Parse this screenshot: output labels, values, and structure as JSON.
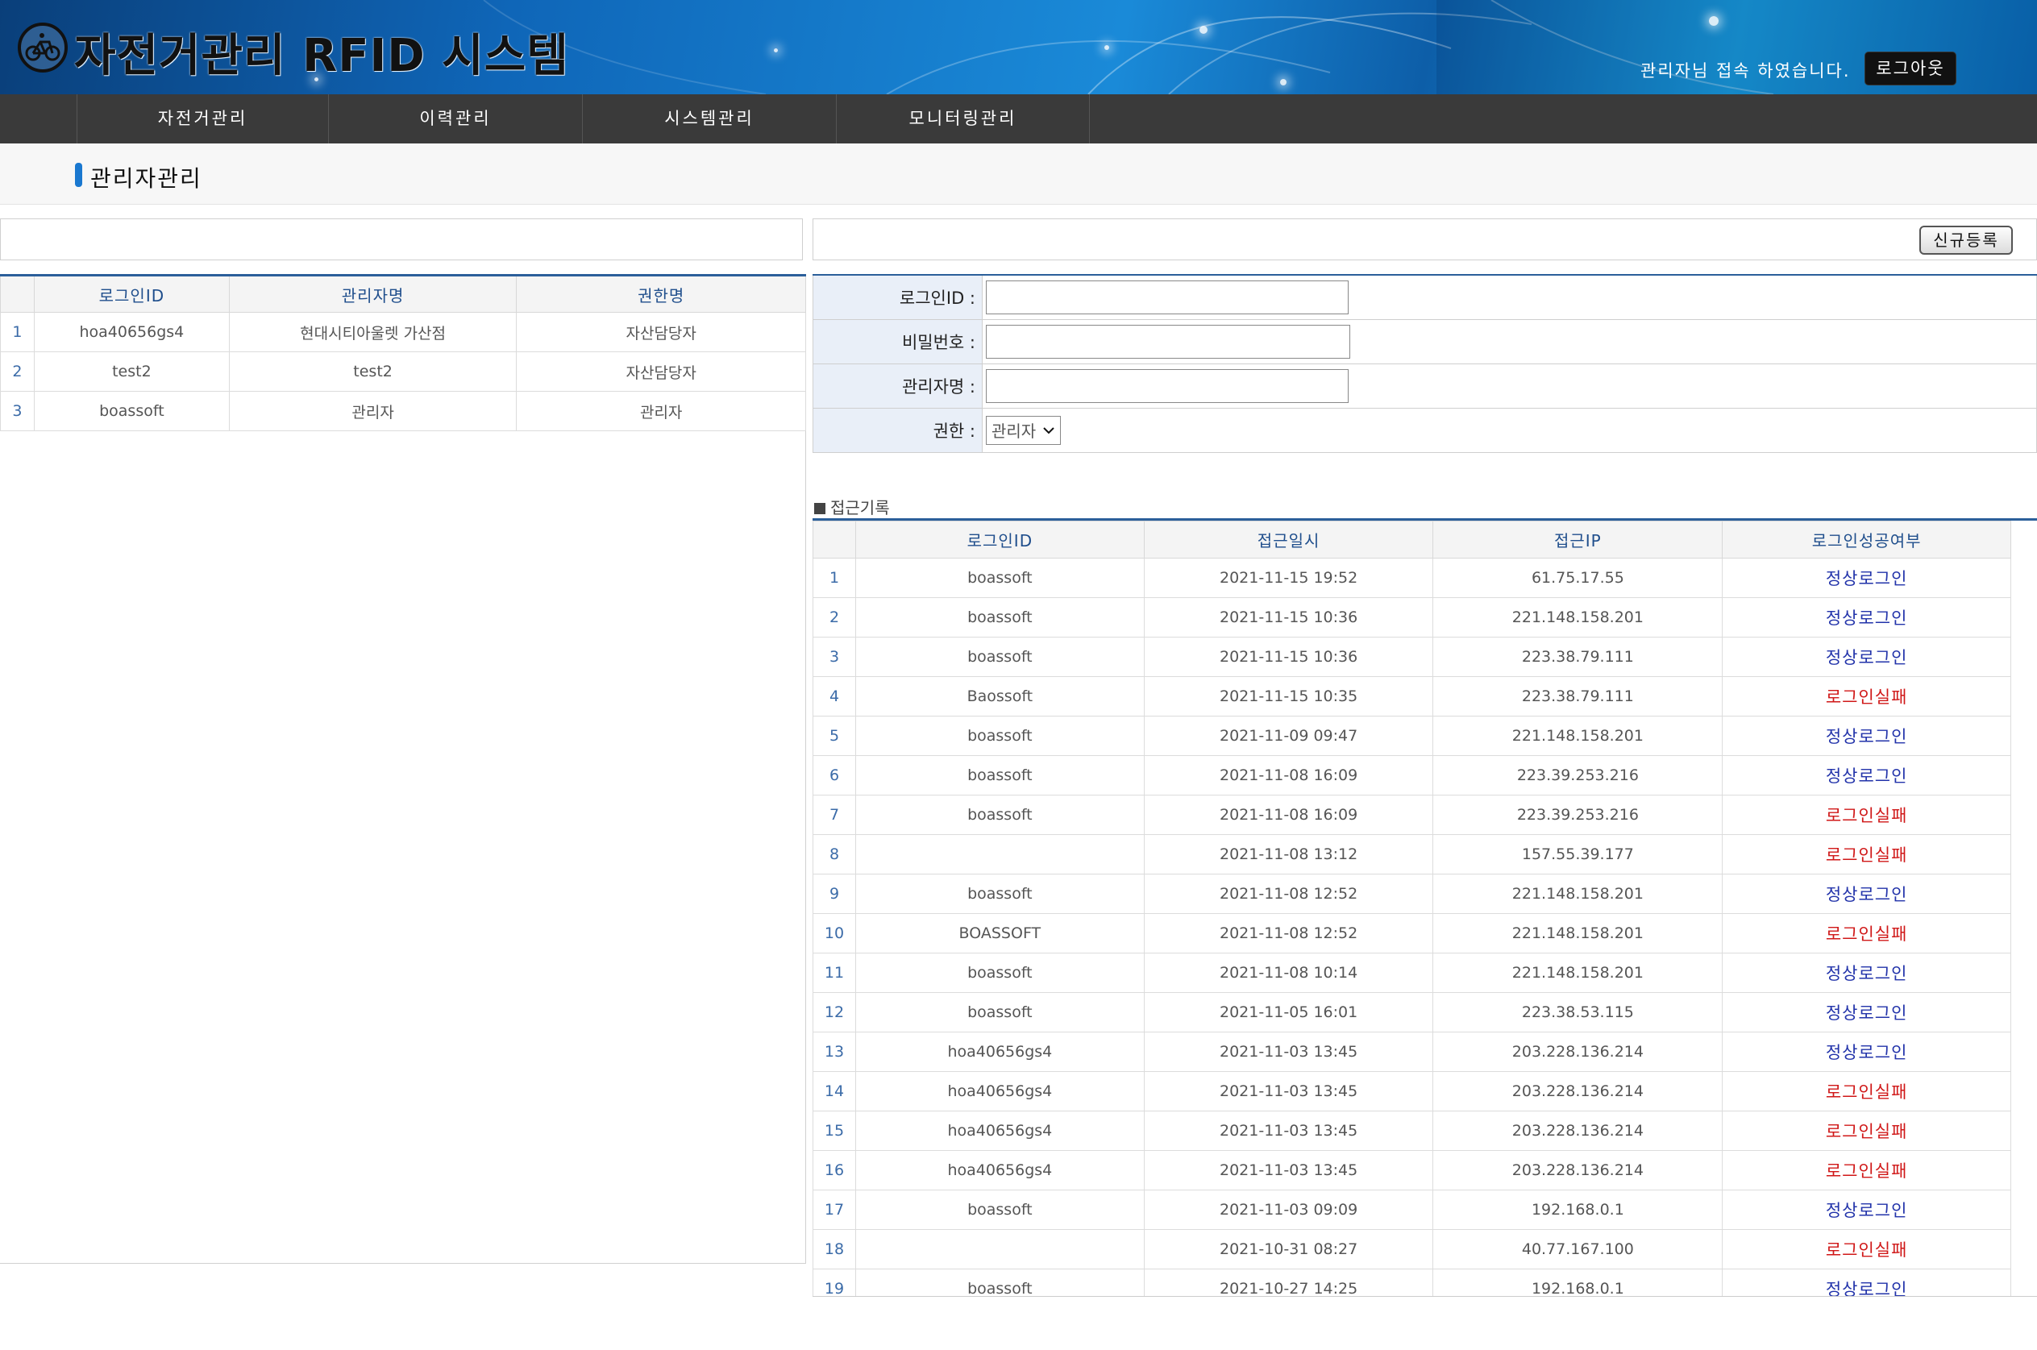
{
  "header": {
    "title": "자전거관리 RFID 시스템",
    "welcome": "관리자님 접속 하였습니다.",
    "logout_label": "로그아웃"
  },
  "nav": {
    "items": [
      {
        "label": "자전거관리"
      },
      {
        "label": "이력관리"
      },
      {
        "label": "시스템관리"
      },
      {
        "label": "모니터링관리"
      }
    ]
  },
  "page": {
    "title": "관리자관리",
    "new_button": "신규등록"
  },
  "admin_table": {
    "headers": [
      "로그인ID",
      "관리자명",
      "권한명"
    ],
    "rows": [
      {
        "no": "1",
        "id": "hoa40656gs4",
        "name": "현대시티아울렛 가산점",
        "role": "자산담당자"
      },
      {
        "no": "2",
        "id": "test2",
        "name": "test2",
        "role": "자산담당자"
      },
      {
        "no": "3",
        "id": "boassoft",
        "name": "관리자",
        "role": "관리자"
      }
    ]
  },
  "form": {
    "login_id_label": "로그인ID :",
    "password_label": "비밀번호 :",
    "manager_name_label": "관리자명 :",
    "role_label": "권한 :",
    "role_value": "관리자",
    "login_id_value": "",
    "password_value": "",
    "manager_name_value": ""
  },
  "access_log": {
    "label": "접근기록",
    "headers": [
      "로그인ID",
      "접근일시",
      "접근IP",
      "로그인성공여부"
    ],
    "rows": [
      {
        "no": "1",
        "id": "boassoft",
        "time": "2021-11-15 19:52",
        "ip": "61.75.17.55",
        "result": "정상로그인",
        "status": "ok"
      },
      {
        "no": "2",
        "id": "boassoft",
        "time": "2021-11-15 10:36",
        "ip": "221.148.158.201",
        "result": "정상로그인",
        "status": "ok"
      },
      {
        "no": "3",
        "id": "boassoft",
        "time": "2021-11-15 10:36",
        "ip": "223.38.79.111",
        "result": "정상로그인",
        "status": "ok"
      },
      {
        "no": "4",
        "id": "Baossoft",
        "time": "2021-11-15 10:35",
        "ip": "223.38.79.111",
        "result": "로그인실패",
        "status": "fail"
      },
      {
        "no": "5",
        "id": "boassoft",
        "time": "2021-11-09 09:47",
        "ip": "221.148.158.201",
        "result": "정상로그인",
        "status": "ok"
      },
      {
        "no": "6",
        "id": "boassoft",
        "time": "2021-11-08 16:09",
        "ip": "223.39.253.216",
        "result": "정상로그인",
        "status": "ok"
      },
      {
        "no": "7",
        "id": "boassoft",
        "time": "2021-11-08 16:09",
        "ip": "223.39.253.216",
        "result": "로그인실패",
        "status": "fail"
      },
      {
        "no": "8",
        "id": "",
        "time": "2021-11-08 13:12",
        "ip": "157.55.39.177",
        "result": "로그인실패",
        "status": "fail"
      },
      {
        "no": "9",
        "id": "boassoft",
        "time": "2021-11-08 12:52",
        "ip": "221.148.158.201",
        "result": "정상로그인",
        "status": "ok"
      },
      {
        "no": "10",
        "id": "BOASSOFT",
        "time": "2021-11-08 12:52",
        "ip": "221.148.158.201",
        "result": "로그인실패",
        "status": "fail"
      },
      {
        "no": "11",
        "id": "boassoft",
        "time": "2021-11-08 10:14",
        "ip": "221.148.158.201",
        "result": "정상로그인",
        "status": "ok"
      },
      {
        "no": "12",
        "id": "boassoft",
        "time": "2021-11-05 16:01",
        "ip": "223.38.53.115",
        "result": "정상로그인",
        "status": "ok"
      },
      {
        "no": "13",
        "id": "hoa40656gs4",
        "time": "2021-11-03 13:45",
        "ip": "203.228.136.214",
        "result": "정상로그인",
        "status": "ok"
      },
      {
        "no": "14",
        "id": "hoa40656gs4",
        "time": "2021-11-03 13:45",
        "ip": "203.228.136.214",
        "result": "로그인실패",
        "status": "fail"
      },
      {
        "no": "15",
        "id": "hoa40656gs4",
        "time": "2021-11-03 13:45",
        "ip": "203.228.136.214",
        "result": "로그인실패",
        "status": "fail"
      },
      {
        "no": "16",
        "id": "hoa40656gs4",
        "time": "2021-11-03 13:45",
        "ip": "203.228.136.214",
        "result": "로그인실패",
        "status": "fail"
      },
      {
        "no": "17",
        "id": "boassoft",
        "time": "2021-11-03 09:09",
        "ip": "192.168.0.1",
        "result": "정상로그인",
        "status": "ok"
      },
      {
        "no": "18",
        "id": "",
        "time": "2021-10-31 08:27",
        "ip": "40.77.167.100",
        "result": "로그인실패",
        "status": "fail"
      },
      {
        "no": "19",
        "id": "boassoft",
        "time": "2021-10-27 14:25",
        "ip": "192.168.0.1",
        "result": "정상로그인",
        "status": "ok"
      }
    ]
  },
  "colors": {
    "ok": "#2233aa",
    "fail": "#d01818",
    "accent": "#2b5f9a"
  },
  "icons": {
    "logo": "bicycle-icon",
    "select_arrow": "chevron-down-icon"
  }
}
